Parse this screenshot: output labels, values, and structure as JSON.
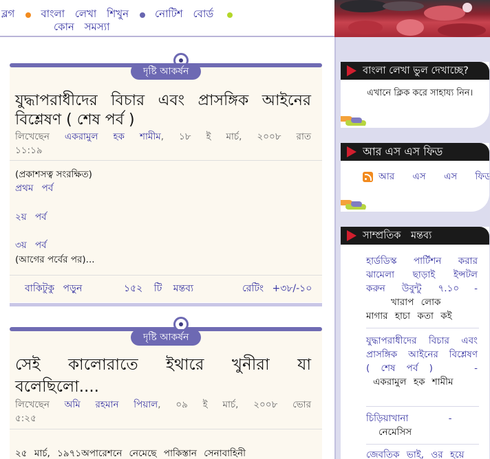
{
  "nav": {
    "items": [
      "ব্লগ",
      "বাংলা লেখা শিখুন",
      "নোটিশ বোর্ড"
    ],
    "item4": "কোন সমস্যা"
  },
  "posts": [
    {
      "badge": "দৃষ্টি আকর্ষন",
      "title_line1": "যুদ্ধাপরাধীদের বিচার এবং প্রাসঙ্গিক আইনের",
      "title_line2": "বিশ্লেষণ ( শেষ পর্ব )",
      "meta_prefix": "লিখেছেন",
      "author": "একরামুল হক শামীম",
      "date": ", ১৮ ই মার্চ, ২০০৮ রাত",
      "time": "১১:১৯",
      "body": [
        "(প্রকাশসত্ব সংরক্ষিত)",
        "প্রথম পর্ব",
        "২য় পর্ব",
        "৩য় পর্ব",
        "(আগের পর্বের পর)..."
      ],
      "read_more": "বাকিটুকু পড়ুন",
      "comments": "১৫২ টি মন্তব্য",
      "rating": "রেটিং +৩৮/-১০"
    },
    {
      "badge": "দৃষ্টি আকর্ষন",
      "title_line1": "সেই কালোরাতে ইথারে খুনীরা যা",
      "title_line2": "বলেছিলো....",
      "meta_prefix": "লিখেছেন",
      "author": "অমি রহমান পিয়াল",
      "date": ", ০৯ ই মার্চ, ২০০৮ ভোর",
      "time": "৫:২৫",
      "body": [
        "২৫ মার্চ, ১৯৭১অপারেশনে নেমেছে পাকিস্তান সেনাবাহিনী"
      ]
    }
  ],
  "sidebar": {
    "help": {
      "title": "বাংলা লেখা ভুল দেখাচ্ছে?",
      "text": "এখানে ক্লিক করে সাহায্য নিন।"
    },
    "rss": {
      "title": "আর এস এস ফিড",
      "link": "আর এস এস ফিড"
    },
    "recent": {
      "title": "সাম্প্রতিক মন্তব্য",
      "comments": [
        {
          "topic": "হার্ডডিস্ক পার্টিশন করার ঝামেলা ছাড়াই ইন্সটল করুন উবুন্টু ৭.১০",
          "dash": "-",
          "author": "খারাপ লোক",
          "text": "মাগার হাচা কতা কই"
        },
        {
          "topic": "যুদ্ধাপরাধীদের বিচার এবং প্রাসঙ্গিক আইনের বিশ্লেষণ ( শেষ পর্ব )",
          "dash": "-",
          "author": "একরামুল হক শামীম"
        },
        {
          "topic": "চিড়িয়াখানা",
          "dash": "-",
          "author": "নেমেসিস"
        },
        {
          "topic": "জেবতিক ভাই, ওর হয়ে"
        }
      ]
    }
  },
  "colors": {
    "accent": "#3b38a4",
    "badge": "#6d69b3",
    "post_bg": "#fcf8ef",
    "sidebar_bg": "#dcdcee",
    "arrow": "#d21e2e"
  }
}
